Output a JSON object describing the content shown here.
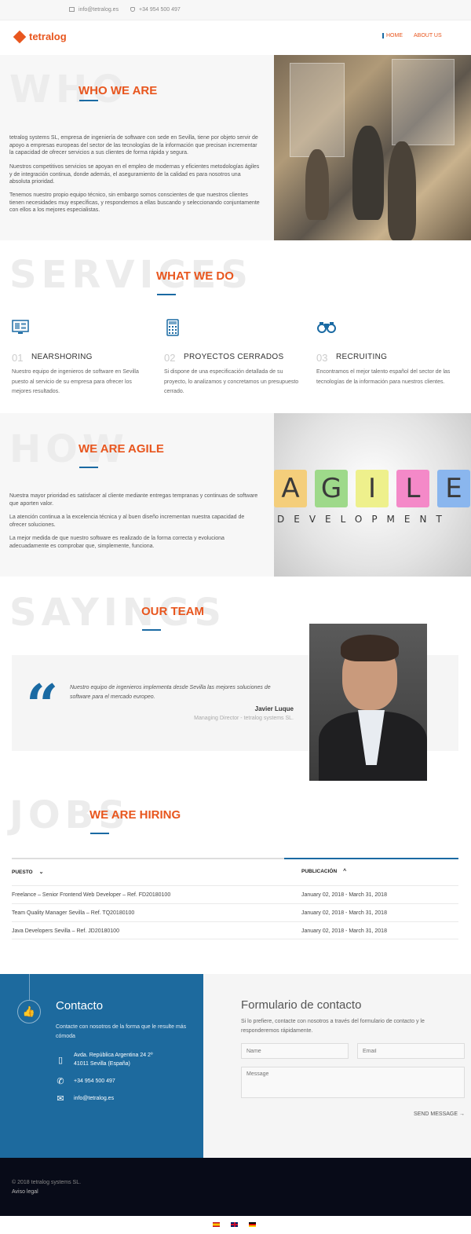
{
  "topbar": {
    "email": "info@tetralog.es",
    "phone": "+34 954 500 497"
  },
  "header": {
    "logo": "tetralog",
    "nav": [
      "HOME",
      "ABOUT US"
    ]
  },
  "who": {
    "bigword": "WHO",
    "title": "WHO WE ARE",
    "paragraphs": [
      "tetralog systems SL, empresa de ingeniería de software con sede en Sevilla, tiene por objeto servir de apoyo a empresas europeas del sector de las tecnologías de la información que precisan incrementar la capacidad de ofrecer servicios a sus clientes de forma rápida y segura.",
      "Nuestros competitivos servicios se apoyan en el empleo de modernas y eficientes metodologías ágiles y de integración continua, donde además, el aseguramiento de la calidad es para nosotros una absoluta prioridad.",
      "Tenemos nuestro propio equipo técnico, sin embargo somos conscientes de que nuestros clientes tienen necesidades muy específicas, y respondemos a ellas buscando y seleccionando conjuntamente con ellos a los mejores especialistas."
    ]
  },
  "services": {
    "bigword": "SERVICES",
    "title": "WHAT WE DO",
    "items": [
      {
        "num": "01",
        "name": "NEARSHORING",
        "desc": "Nuestro equipo de ingenieros de software en Sevilla puesto al servicio de su empresa para ofrecer los mejores resultados.",
        "icon": "monitor-icon"
      },
      {
        "num": "02",
        "name": "PROYECTOS CERRADOS",
        "desc": "Si dispone de una especificación detallada de su proyecto, lo analizamos y concretamos un presupuesto cerrado.",
        "icon": "calculator-icon"
      },
      {
        "num": "03",
        "name": "RECRUITING",
        "desc": "Encontramos el mejor talento español del sector de las tecnologías de la información para nuestros clientes.",
        "icon": "binoculars-icon"
      }
    ]
  },
  "agile": {
    "bigword": "HOW",
    "title": "WE ARE AGILE",
    "paragraphs": [
      "Nuestra mayor prioridad es satisfacer al cliente mediante entregas tempranas y continuas de software que aporten valor.",
      "La atención continua a la excelencia técnica y al buen diseño incrementan nuestra capacidad de ofrecer soluciones.",
      "La mejor medida de que nuestro software es realizado de la forma correcta y evoluciona adecuadamente es comprobar que, simplemente, funciona."
    ],
    "image_letters": [
      "A",
      "G",
      "I",
      "L",
      "E"
    ],
    "image_subtitle": "DEVELOPMENT"
  },
  "team": {
    "bigword": "SAYINGS",
    "title": "OUR TEAM",
    "quote": "Nuestro equipo de ingenieros implementa desde Sevilla las mejores soluciones de software para el mercado europeo.",
    "name": "Javier Luque",
    "role": "Managing Director - tetralog systems SL."
  },
  "jobs": {
    "bigword": "JOBS",
    "title": "WE ARE HIRING",
    "headers": [
      "PUESTO",
      "PUBLICACIÓN"
    ],
    "rows": [
      {
        "position": "Freelance – Senior Frontend Web Developer – Ref. FD20180100",
        "date": "January 02, 2018 - March 31, 2018"
      },
      {
        "position": "Team Quality Manager Sevilla – Ref. TQ20180100",
        "date": "January 02, 2018 - March 31, 2018"
      },
      {
        "position": "Java Developers Sevilla – Ref. JD20180100",
        "date": "January 02, 2018 - March 31, 2018"
      }
    ]
  },
  "contact": {
    "title": "Contacto",
    "subtitle": "Contacte con nosotros de la forma que le resulte más cómoda",
    "address_line1": "Avda. República Argentina 24 2º",
    "address_line2": "41011 Sevilla (España)",
    "phone": "+34 954 500 497",
    "email": "info@tetralog.es",
    "form_title": "Formulario de contacto",
    "form_sub": "Si lo prefiere, contacte con nosotros a través del formulario de contacto y le responderemos rápidamente.",
    "name_placeholder": "Name",
    "email_placeholder": "Email",
    "message_placeholder": "Message",
    "send": "SEND MESSAGE →"
  },
  "footer": {
    "copyright": "© 2018 tetralog systems SL.",
    "legal": "Aviso legal"
  },
  "colors": {
    "accent": "#e8561e",
    "brand_blue": "#1d6a9e",
    "footer_bg": "#080b18"
  }
}
